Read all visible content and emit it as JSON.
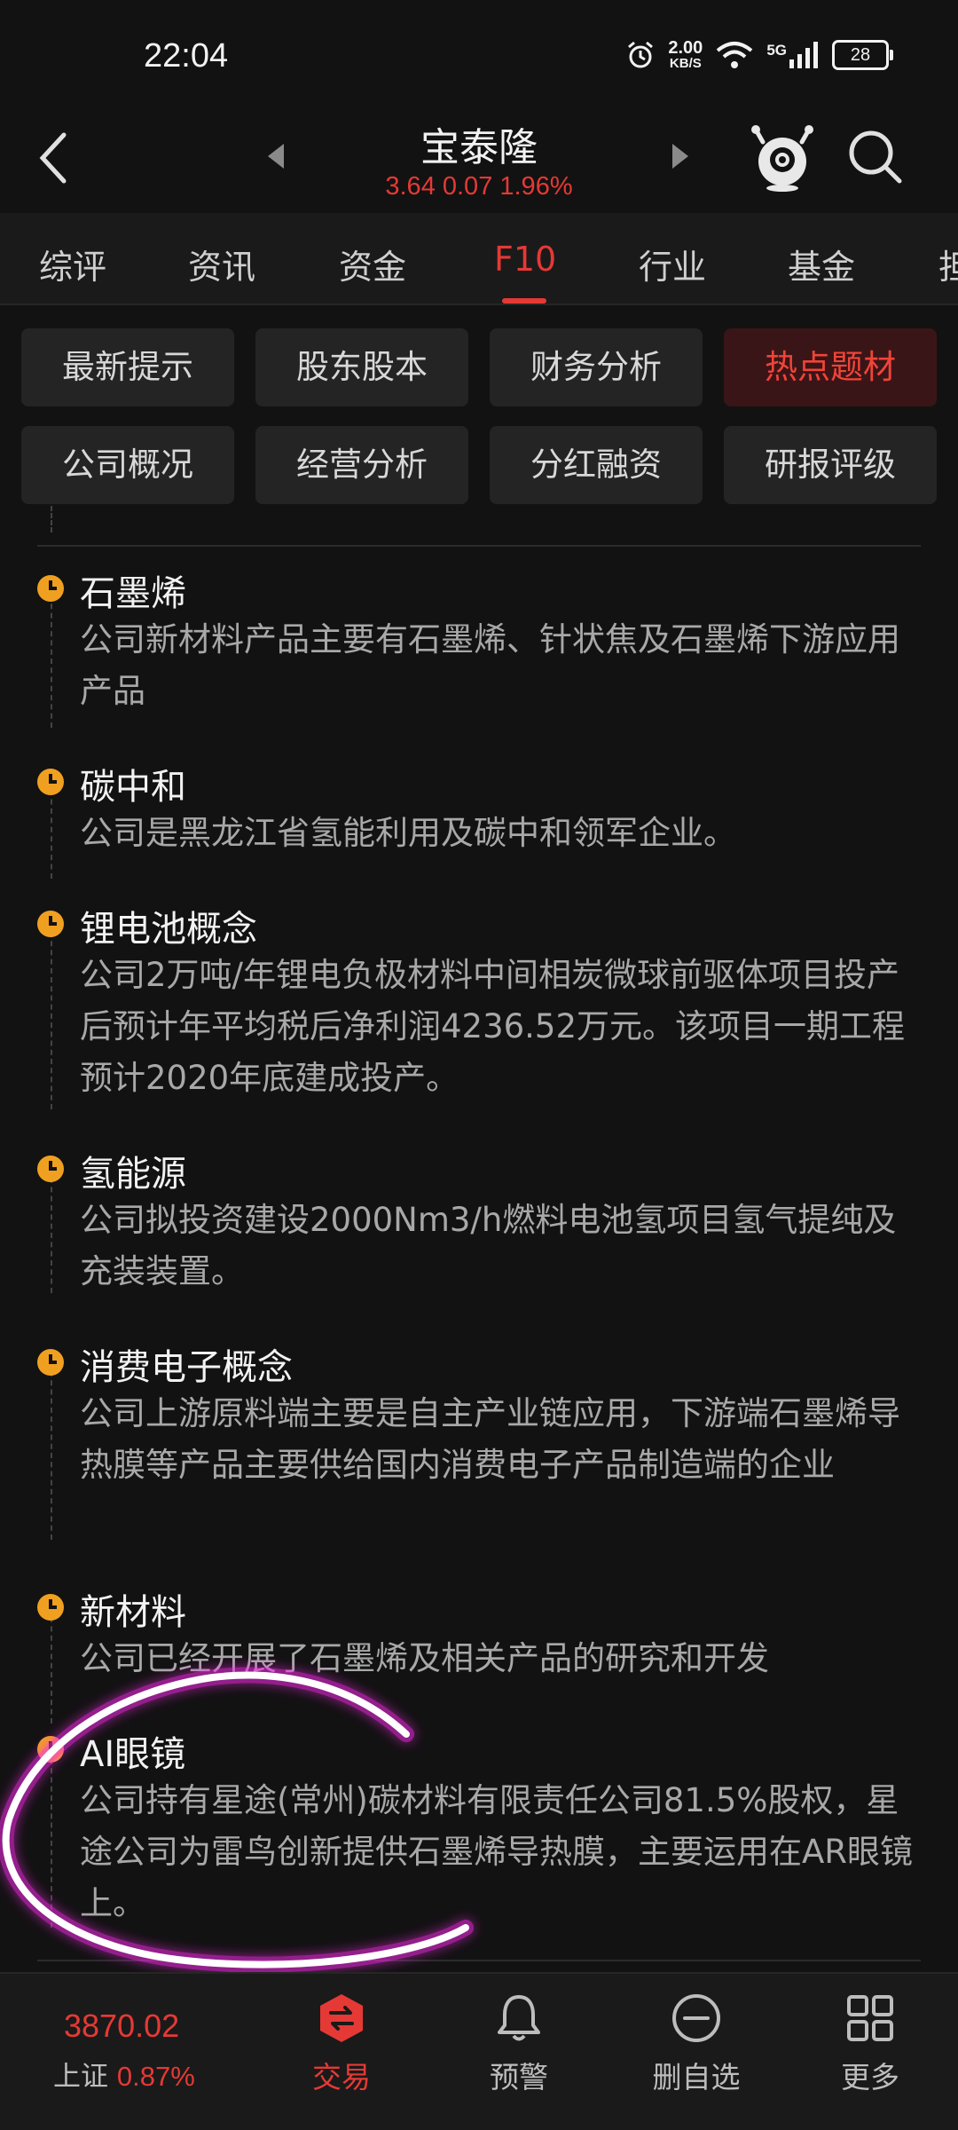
{
  "status_bar": {
    "time": "22:04",
    "speed_value": "2.00",
    "speed_unit": "KB/S",
    "network": "5G",
    "battery": "28"
  },
  "header": {
    "title": "宝泰隆",
    "quote": "3.64 0.07 1.96%"
  },
  "tabs": [
    "综评",
    "资讯",
    "资金",
    "F10",
    "行业",
    "基金",
    "担"
  ],
  "active_tab": "F10",
  "subnav": {
    "row1": [
      "最新提示",
      "股东股本",
      "财务分析",
      "热点题材"
    ],
    "row2": [
      "公司概况",
      "经营分析",
      "分红融资",
      "研报评级"
    ],
    "active": "热点题材"
  },
  "topics": [
    {
      "title": "石墨烯",
      "desc": "公司新材料产品主要有石墨烯、针状焦及石墨烯下游应用产品"
    },
    {
      "title": "碳中和",
      "desc": "公司是黑龙江省氢能利用及碳中和领军企业。"
    },
    {
      "title": "锂电池概念",
      "desc": "公司2万吨/年锂电负极材料中间相炭微球前驱体项目投产后预计年平均税后净利润4236.52万元。该项目一期工程预计2020年底建成投产。"
    },
    {
      "title": "氢能源",
      "desc": "公司拟投资建设2000Nm3/h燃料电池氢项目氢气提纯及充装装置。"
    },
    {
      "title": "消费电子概念",
      "desc": "公司上游原料端主要是自主产业链应用，下游端石墨烯导热膜等产品主要供给国内消费电子产品制造端的企业"
    },
    {
      "title": "新材料",
      "desc": "公司已经开展了石墨烯及相关产品的研究和开发"
    },
    {
      "title": "AI眼镜",
      "desc": "公司持有星途(常州)碳材料有限责任公司81.5%股权，星途公司为雷鸟创新提供石墨烯导热膜，主要运用在AR眼镜上。"
    }
  ],
  "bottom_nav": {
    "index_value": "3870.02",
    "index_name": "上证",
    "index_pct": "0.87%",
    "items": [
      "交易",
      "预警",
      "删自选",
      "更多"
    ]
  },
  "colors": {
    "accent_red": "#e53935",
    "timeline_dot": "#f0a020",
    "annotation": "#ff2cf0"
  },
  "icons": [
    "back-arrow-icon",
    "prev-stock-icon",
    "next-stock-icon",
    "mascot-icon",
    "search-icon",
    "trade-icon",
    "bell-icon",
    "remove-circle-icon",
    "grid-more-icon"
  ]
}
